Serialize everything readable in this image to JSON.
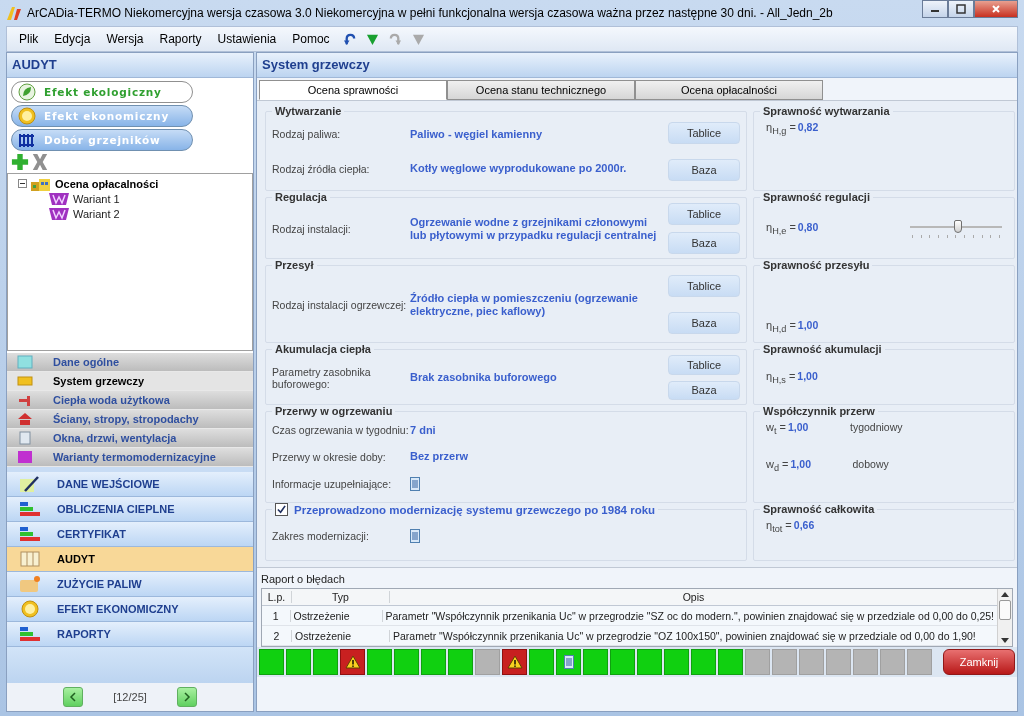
{
  "window": {
    "title": "ArCADia-TERMO Niekomercyjna wersja czasowa 3.0 Niekomercyjna w pełni funkcjonalna wersja czasowa ważna przez następne 30 dni. - All_Jedn_2b"
  },
  "menu": [
    "Plik",
    "Edycja",
    "Wersja",
    "Raporty",
    "Ustawienia",
    "Pomoc"
  ],
  "toolbar": [
    {
      "kind": "undo",
      "disabled": false
    },
    {
      "kind": "down",
      "disabled": false
    },
    {
      "kind": "redo",
      "disabled": true
    },
    {
      "kind": "down",
      "disabled": true
    }
  ],
  "sidebar": {
    "title": "AUDYT",
    "pills": [
      {
        "label": "Efekt ekologiczny",
        "selected": true
      },
      {
        "label": "Efekt ekonomiczny",
        "selected": false
      },
      {
        "label": "Dobór grzejników",
        "selected": false
      }
    ],
    "tree": [
      {
        "label": "Ocena opłacalności",
        "expanded": true,
        "children": [
          {
            "label": "Wariant 1"
          },
          {
            "label": "Wariant 2"
          }
        ]
      }
    ],
    "sections": [
      {
        "label": "Dane ogólne",
        "selected": false
      },
      {
        "label": "System grzewczy",
        "selected": true
      },
      {
        "label": "Ciepła woda użytkowa",
        "selected": false
      },
      {
        "label": "Ściany, stropy, stropodachy",
        "selected": false
      },
      {
        "label": "Okna, drzwi, wentylacja",
        "selected": false
      },
      {
        "label": "Warianty termomodernizacyjne",
        "selected": false
      }
    ],
    "nav": [
      {
        "label": "DANE WEJŚCIOWE",
        "selected": false
      },
      {
        "label": "OBLICZENIA CIEPLNE",
        "selected": false
      },
      {
        "label": "CERTYFIKAT",
        "selected": false
      },
      {
        "label": "AUDYT",
        "selected": true
      },
      {
        "label": "ZUŻYCIE PALIW",
        "selected": false
      },
      {
        "label": "EFEKT EKONOMICZNY",
        "selected": false
      },
      {
        "label": "RAPORTY",
        "selected": false
      }
    ],
    "pager": "[12/25]"
  },
  "main": {
    "title": "System grzewczy",
    "tabs": [
      {
        "label": "Ocena sprawności",
        "selected": true
      },
      {
        "label": "Ocena stanu technicznego",
        "selected": false
      },
      {
        "label": "Ocena opłacalności",
        "selected": false
      }
    ],
    "groups": [
      {
        "title": "Wytwarzanie",
        "kind": "plain",
        "rows": [
          {
            "kind": "text",
            "label": "Rodzaj paliwa:",
            "value": "Paliwo - węgiel kamienny"
          },
          {
            "kind": "text",
            "label": "Rodzaj źródła ciepła:",
            "value": "Kotły węglowe wyprodukowane po 2000r."
          }
        ],
        "buttons": [
          "Tablice",
          "Baza"
        ]
      },
      {
        "title": "Regulacja",
        "kind": "plain",
        "rows": [
          {
            "kind": "text",
            "label": "Rodzaj instalacji:",
            "value": "Ogrzewanie wodne z grzejnikami członowymi lub płytowymi w przypadku regulacji centralnej"
          }
        ],
        "buttons": [
          "Tablice",
          "Baza"
        ]
      },
      {
        "title": "Przesył",
        "kind": "plain",
        "rows": [
          {
            "kind": "text",
            "label": "Rodzaj instalacji ogrzewczej:",
            "value": "Źródło ciepła w pomieszczeniu (ogrzewanie elektryczne, piec kaflowy)"
          }
        ],
        "buttons": [
          "Tablice",
          "Baza"
        ]
      },
      {
        "title": "Akumulacja ciepła",
        "kind": "plain",
        "rows": [
          {
            "kind": "text",
            "label": "Parametry zasobnika buforowego:",
            "value": "Brak zasobnika buforowego"
          }
        ],
        "buttons": [
          "Tablice",
          "Baza"
        ]
      },
      {
        "title": "Przerwy w ogrzewaniu",
        "kind": "plain",
        "rows": [
          {
            "kind": "text",
            "label": "Czas ogrzewania w tygodniu:",
            "value": "7 dni"
          },
          {
            "kind": "text",
            "label": "Przerwy w okresie doby:",
            "value": "Bez przerw"
          },
          {
            "kind": "note",
            "label": "Informacje uzupełniające:"
          }
        ]
      },
      {
        "title": "Przeprowadzono modernizację systemu grzewczego po 1984 roku",
        "kind": "checkbox",
        "checked": true,
        "rows": [
          {
            "kind": "note",
            "label": "Zakres modernizacji:"
          }
        ]
      }
    ],
    "results": [
      {
        "title": "Sprawność wytwarzania",
        "formulas": [
          {
            "symbol": "η$_{H,g}$ =",
            "value": "0,82"
          }
        ]
      },
      {
        "title": "Sprawność regulacji",
        "formulas": [
          {
            "symbol": "η$_{H,e}$ =",
            "value": "0,80"
          }
        ],
        "slider": {
          "level": 0.52
        }
      },
      {
        "title": "Sprawność przesyłu",
        "formulas": [
          {
            "symbol": "η$_{H,d}$ =",
            "value": "1,00"
          }
        ]
      },
      {
        "title": "Sprawność akumulacji",
        "formulas": [
          {
            "symbol": "η$_{H,s}$ =",
            "value": "1,00"
          }
        ]
      },
      {
        "title": "Współczynnik przerw",
        "formulas": [
          {
            "symbol": "w$_{t}$ =",
            "value": "1,00",
            "note": "tygodniowy"
          },
          {
            "symbol": "w$_{d}$ =",
            "value": "1,00",
            "note": "dobowy"
          }
        ]
      },
      {
        "title": "Sprawność całkowita",
        "formulas": [
          {
            "symbol": "η$_{tot}$ =",
            "value": "0,66"
          }
        ]
      }
    ]
  },
  "errors": {
    "title": "Raport o błędach",
    "columns": [
      "L.p.",
      "Typ",
      "Opis"
    ],
    "rows": [
      {
        "no": "1",
        "type": "Ostrzeżenie",
        "text": "Parametr \"Współczynnik przenikania Uc\" w przegrodzie \"SZ oc do modern.\", powinien znajdować się w przedziale od 0,00 do 0,25!"
      },
      {
        "no": "2",
        "type": "Ostrzeżenie",
        "text": "Parametr \"Współczynnik przenikania Uc\" w przegrodzie \"OZ 100x150\", powinien znajdować się w przedziale od 0,00 do 1,90!"
      }
    ]
  },
  "status_cells": [
    {
      "kind": "ok"
    },
    {
      "kind": "ok"
    },
    {
      "kind": "ok"
    },
    {
      "kind": "warning"
    },
    {
      "kind": "ok"
    },
    {
      "kind": "ok"
    },
    {
      "kind": "ok"
    },
    {
      "kind": "ok"
    },
    {
      "kind": "empty"
    },
    {
      "kind": "warning"
    },
    {
      "kind": "ok"
    },
    {
      "kind": "note"
    },
    {
      "kind": "ok"
    },
    {
      "kind": "ok"
    },
    {
      "kind": "ok"
    },
    {
      "kind": "ok"
    },
    {
      "kind": "ok"
    },
    {
      "kind": "ok"
    },
    {
      "kind": "empty"
    },
    {
      "kind": "empty"
    },
    {
      "kind": "empty"
    },
    {
      "kind": "empty"
    },
    {
      "kind": "empty"
    },
    {
      "kind": "empty"
    },
    {
      "kind": "empty"
    }
  ],
  "close_button": "Zamknij"
}
